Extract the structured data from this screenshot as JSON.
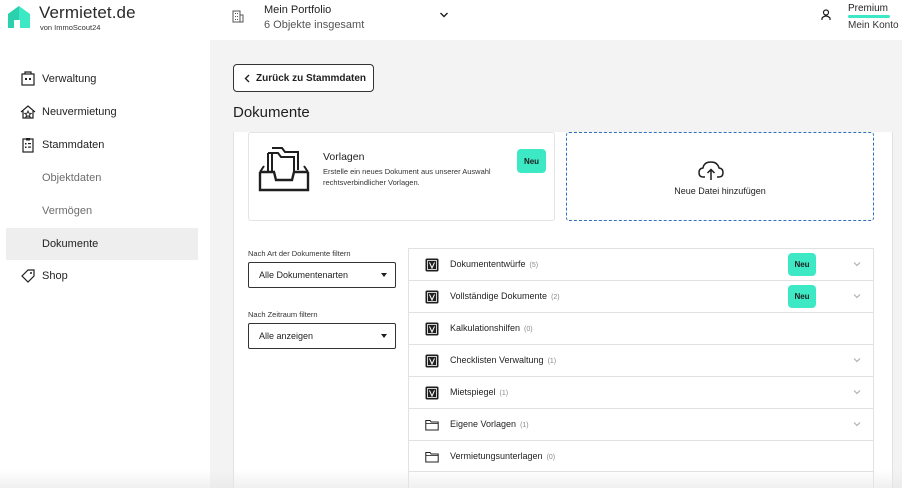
{
  "header": {
    "brand": "Vermietet.de",
    "brand_sub": "von ImmoScout24",
    "portfolio_title": "Mein Portfolio",
    "portfolio_sub": "6 Objekte insgesamt",
    "premium_label": "Premium",
    "account_label": "Mein Konto",
    "accent_color": "#3de8c4"
  },
  "sidebar": {
    "items": [
      {
        "label": "Verwaltung",
        "icon": "building-icon"
      },
      {
        "label": "Neuvermietung",
        "icon": "house-star-icon"
      },
      {
        "label": "Stammdaten",
        "icon": "clipboard-icon"
      },
      {
        "label": "Objektdaten"
      },
      {
        "label": "Vermögen"
      },
      {
        "label": "Dokumente"
      },
      {
        "label": "Shop",
        "icon": "tag-icon"
      }
    ]
  },
  "main": {
    "back_label": "Zurück zu Stammdaten",
    "page_title": "Dokumente",
    "vorlagen": {
      "title": "Vorlagen",
      "description": "Erstelle ein neues Dokument aus unserer Auswahl rechtsverbindlicher Vorlagen.",
      "badge": "Neu"
    },
    "upload_label": "Neue Datei hinzufügen",
    "filters": {
      "type_label": "Nach Art der Dokumente filtern",
      "type_value": "Alle Dokumentenarten",
      "time_label": "Nach Zeitraum filtern",
      "time_value": "Alle anzeigen"
    },
    "documents": [
      {
        "label": "Dokumententwürfe",
        "count": "(5)",
        "badge": "Neu",
        "icon": "v-doc-icon"
      },
      {
        "label": "Vollständige Dokumente",
        "count": "(2)",
        "badge": "Neu",
        "icon": "v-doc-icon"
      },
      {
        "label": "Kalkulationshilfen",
        "count": "(0)",
        "icon": "v-doc-icon"
      },
      {
        "label": "Checklisten Verwaltung",
        "count": "(1)",
        "icon": "v-doc-icon"
      },
      {
        "label": "Mietspiegel",
        "count": "(1)",
        "icon": "v-doc-icon"
      },
      {
        "label": "Eigene Vorlagen",
        "count": "(1)",
        "icon": "folder-icon"
      },
      {
        "label": "Vermietungsunterlagen",
        "count": "(0)",
        "icon": "folder-icon"
      }
    ]
  }
}
